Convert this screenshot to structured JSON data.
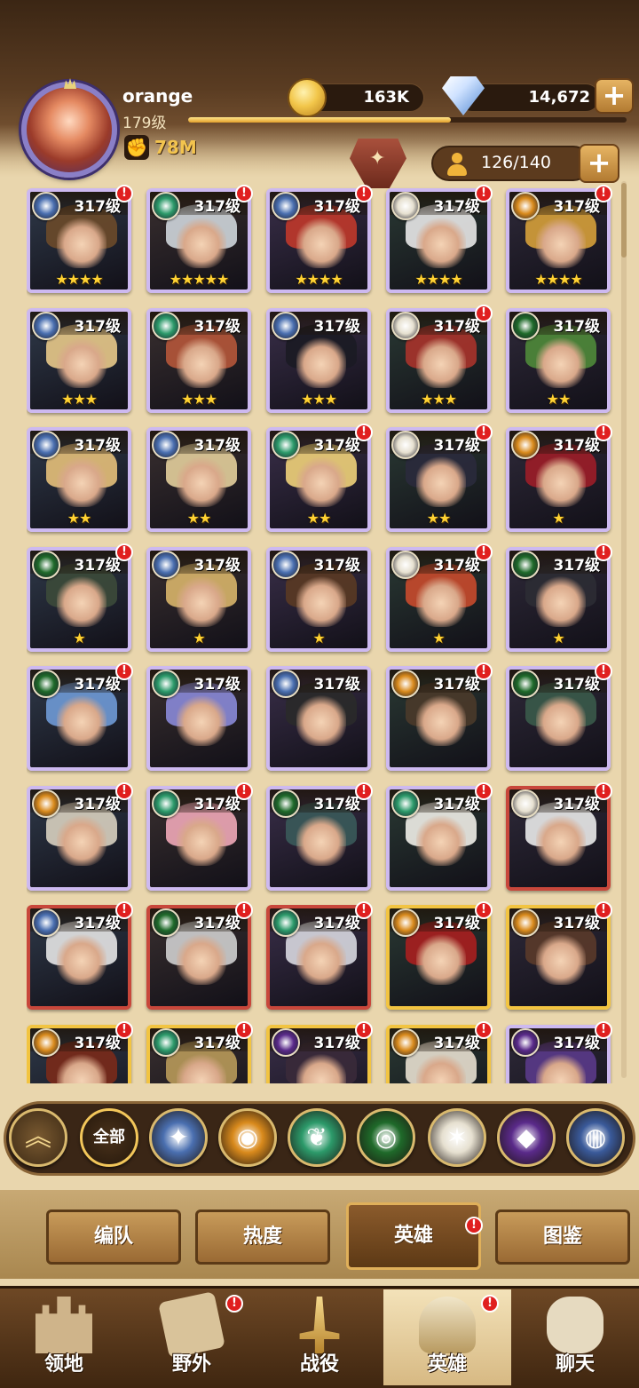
{
  "player": {
    "name": "orange",
    "level_label": "179级",
    "xp_fraction": 0.6,
    "power": "78M"
  },
  "resources": {
    "gold": "163K",
    "gems": "14,672",
    "roster": "126/140"
  },
  "icons": {
    "plus": "+",
    "alert": "!",
    "star": "★",
    "collapse": "︽"
  },
  "heroes": [
    {
      "level": "317级",
      "stars": "★★★★",
      "faction": "lightbearer",
      "rarity": "purple",
      "alert": true,
      "hair": "#6b4a2a"
    },
    {
      "level": "317级",
      "stars": "★★★★★",
      "faction": "wilder",
      "rarity": "purple",
      "alert": true,
      "hair": "#cfd6dc"
    },
    {
      "level": "317级",
      "stars": "★★★★",
      "faction": "lightbearer",
      "rarity": "purple",
      "alert": true,
      "hair": "#c0392b"
    },
    {
      "level": "317级",
      "stars": "★★★★",
      "faction": "celestial",
      "rarity": "purple",
      "alert": true,
      "hair": "#e8e8e8"
    },
    {
      "level": "317级",
      "stars": "★★★★",
      "faction": "mauler",
      "rarity": "purple",
      "alert": true,
      "hair": "#d6a03a"
    },
    {
      "level": "317级",
      "stars": "★★★",
      "faction": "lightbearer",
      "rarity": "purple",
      "alert": false,
      "hair": "#e8c98a"
    },
    {
      "level": "317级",
      "stars": "★★★",
      "faction": "wilder",
      "rarity": "purple",
      "alert": false,
      "hair": "#b5563a"
    },
    {
      "level": "317级",
      "stars": "★★★",
      "faction": "lightbearer",
      "rarity": "purple",
      "alert": false,
      "hair": "#1b1b24"
    },
    {
      "level": "317级",
      "stars": "★★★",
      "faction": "celestial",
      "rarity": "purple",
      "alert": true,
      "hair": "#a8332b"
    },
    {
      "level": "317级",
      "stars": "★★",
      "faction": "graveborn",
      "rarity": "purple",
      "alert": false,
      "hair": "#4f8a3a"
    },
    {
      "level": "317级",
      "stars": "★★",
      "faction": "lightbearer",
      "rarity": "purple",
      "alert": false,
      "hair": "#e6c07a"
    },
    {
      "level": "317级",
      "stars": "★★",
      "faction": "lightbearer",
      "rarity": "purple",
      "alert": false,
      "hair": "#e3cf9c"
    },
    {
      "level": "317级",
      "stars": "★★",
      "faction": "wilder",
      "rarity": "purple",
      "alert": true,
      "hair": "#f0d27a"
    },
    {
      "level": "317级",
      "stars": "★★",
      "faction": "celestial",
      "rarity": "purple",
      "alert": true,
      "hair": "#2a2a3c"
    },
    {
      "level": "317级",
      "stars": "★",
      "faction": "mauler",
      "rarity": "purple",
      "alert": true,
      "hair": "#9c1d28"
    },
    {
      "level": "317级",
      "stars": "★",
      "faction": "graveborn",
      "rarity": "purple",
      "alert": true,
      "hair": "#3c4a3a"
    },
    {
      "level": "317级",
      "stars": "★",
      "faction": "lightbearer",
      "rarity": "purple",
      "alert": false,
      "hair": "#d8b56a"
    },
    {
      "level": "317级",
      "stars": "★",
      "faction": "lightbearer",
      "rarity": "purple",
      "alert": false,
      "hair": "#5a3a24"
    },
    {
      "level": "317级",
      "stars": "★",
      "faction": "celestial",
      "rarity": "purple",
      "alert": true,
      "hair": "#c84a2c"
    },
    {
      "level": "317级",
      "stars": "★",
      "faction": "graveborn",
      "rarity": "purple",
      "alert": true,
      "hair": "#2c2c34"
    },
    {
      "level": "317级",
      "stars": "",
      "faction": "graveborn",
      "rarity": "purple",
      "alert": true,
      "hair": "#6f9ad6"
    },
    {
      "level": "317级",
      "stars": "",
      "faction": "wilder",
      "rarity": "purple",
      "alert": false,
      "hair": "#8a8ad8"
    },
    {
      "level": "317级",
      "stars": "",
      "faction": "lightbearer",
      "rarity": "purple",
      "alert": false,
      "hair": "#2a2a2a"
    },
    {
      "level": "317级",
      "stars": "",
      "faction": "mauler",
      "rarity": "purple",
      "alert": true,
      "hair": "#4a3a2a"
    },
    {
      "level": "317级",
      "stars": "",
      "faction": "graveborn",
      "rarity": "purple",
      "alert": true,
      "hair": "#3a5a4a"
    },
    {
      "level": "317级",
      "stars": "",
      "faction": "mauler",
      "rarity": "purple",
      "alert": true,
      "hair": "#d8d0c0"
    },
    {
      "level": "317级",
      "stars": "",
      "faction": "wilder",
      "rarity": "purple",
      "alert": true,
      "hair": "#f0a8b8"
    },
    {
      "level": "317级",
      "stars": "",
      "faction": "graveborn",
      "rarity": "purple",
      "alert": true,
      "hair": "#3a5a5a"
    },
    {
      "level": "317级",
      "stars": "",
      "faction": "wilder",
      "rarity": "purple",
      "alert": true,
      "hair": "#f0eee8"
    },
    {
      "level": "317级",
      "stars": "",
      "faction": "celestial",
      "rarity": "red",
      "alert": true,
      "hair": "#eaeaea"
    },
    {
      "level": "317级",
      "stars": "",
      "faction": "lightbearer",
      "rarity": "red",
      "alert": true,
      "hair": "#e6e6e6"
    },
    {
      "level": "317级",
      "stars": "",
      "faction": "graveborn",
      "rarity": "red",
      "alert": true,
      "hair": "#cfcfcf"
    },
    {
      "level": "317级",
      "stars": "",
      "faction": "wilder",
      "rarity": "red",
      "alert": true,
      "hair": "#d8d8e0"
    },
    {
      "level": "317级",
      "stars": "",
      "faction": "mauler",
      "rarity": "gold",
      "alert": true,
      "hair": "#a81f1f"
    },
    {
      "level": "317级",
      "stars": "",
      "faction": "mauler",
      "rarity": "gold",
      "alert": true,
      "hair": "#5a3a2a"
    },
    {
      "level": "317级",
      "stars": "",
      "faction": "mauler",
      "rarity": "gold",
      "alert": true,
      "hair": "#7a2a1a"
    },
    {
      "level": "317级",
      "stars": "",
      "faction": "wilder",
      "rarity": "gold",
      "alert": true,
      "hair": "#b89a5a"
    },
    {
      "level": "317级",
      "stars": "",
      "faction": "hypogean",
      "rarity": "gold",
      "alert": true,
      "hair": "#3a2a3a"
    },
    {
      "level": "317级",
      "stars": "",
      "faction": "mauler",
      "rarity": "gold",
      "alert": true,
      "hair": "#e8e0d0"
    },
    {
      "level": "317级",
      "stars": "",
      "faction": "hypogean",
      "rarity": "purple",
      "alert": true,
      "hair": "#5a3a8a"
    }
  ],
  "factions": [
    {
      "id": "lightbearer",
      "icon": "compass-star-icon",
      "color": "#4a6fb0",
      "glyph": "✦"
    },
    {
      "id": "mauler",
      "icon": "fist-emblem-icon",
      "color": "#d98a1c",
      "glyph": "◉"
    },
    {
      "id": "wilder",
      "icon": "leaf-icon",
      "color": "#2c9a6a",
      "glyph": "❦"
    },
    {
      "id": "graveborn",
      "icon": "eye-icon",
      "color": "#1f6a2a",
      "glyph": "◎"
    },
    {
      "id": "celestial",
      "icon": "sunburst-icon",
      "color": "#e6e0d0",
      "glyph": "✶"
    },
    {
      "id": "hypogean",
      "icon": "dark-crystal-icon",
      "color": "#5a2a8a",
      "glyph": "◆"
    },
    {
      "id": "dimensional",
      "icon": "portal-icon",
      "color": "#3a5a9a",
      "glyph": "◍"
    }
  ],
  "filter": {
    "all_label": "全部"
  },
  "subtabs": [
    {
      "label": "编队",
      "active": false,
      "alert": false
    },
    {
      "label": "热度",
      "active": false,
      "alert": false
    },
    {
      "label": "英雄",
      "active": true,
      "alert": true
    },
    {
      "label": "图鉴",
      "active": false,
      "alert": false
    }
  ],
  "nav": [
    {
      "label": "领地",
      "icon": "castle-icon",
      "active": false,
      "alert": false
    },
    {
      "label": "野外",
      "icon": "scroll-map-icon",
      "active": false,
      "alert": true
    },
    {
      "label": "战役",
      "icon": "crossed-swords-icon",
      "active": false,
      "alert": false
    },
    {
      "label": "英雄",
      "icon": "helmet-icon",
      "active": true,
      "alert": true
    },
    {
      "label": "聊天",
      "icon": "chat-bubble-icon",
      "active": false,
      "alert": false
    }
  ]
}
